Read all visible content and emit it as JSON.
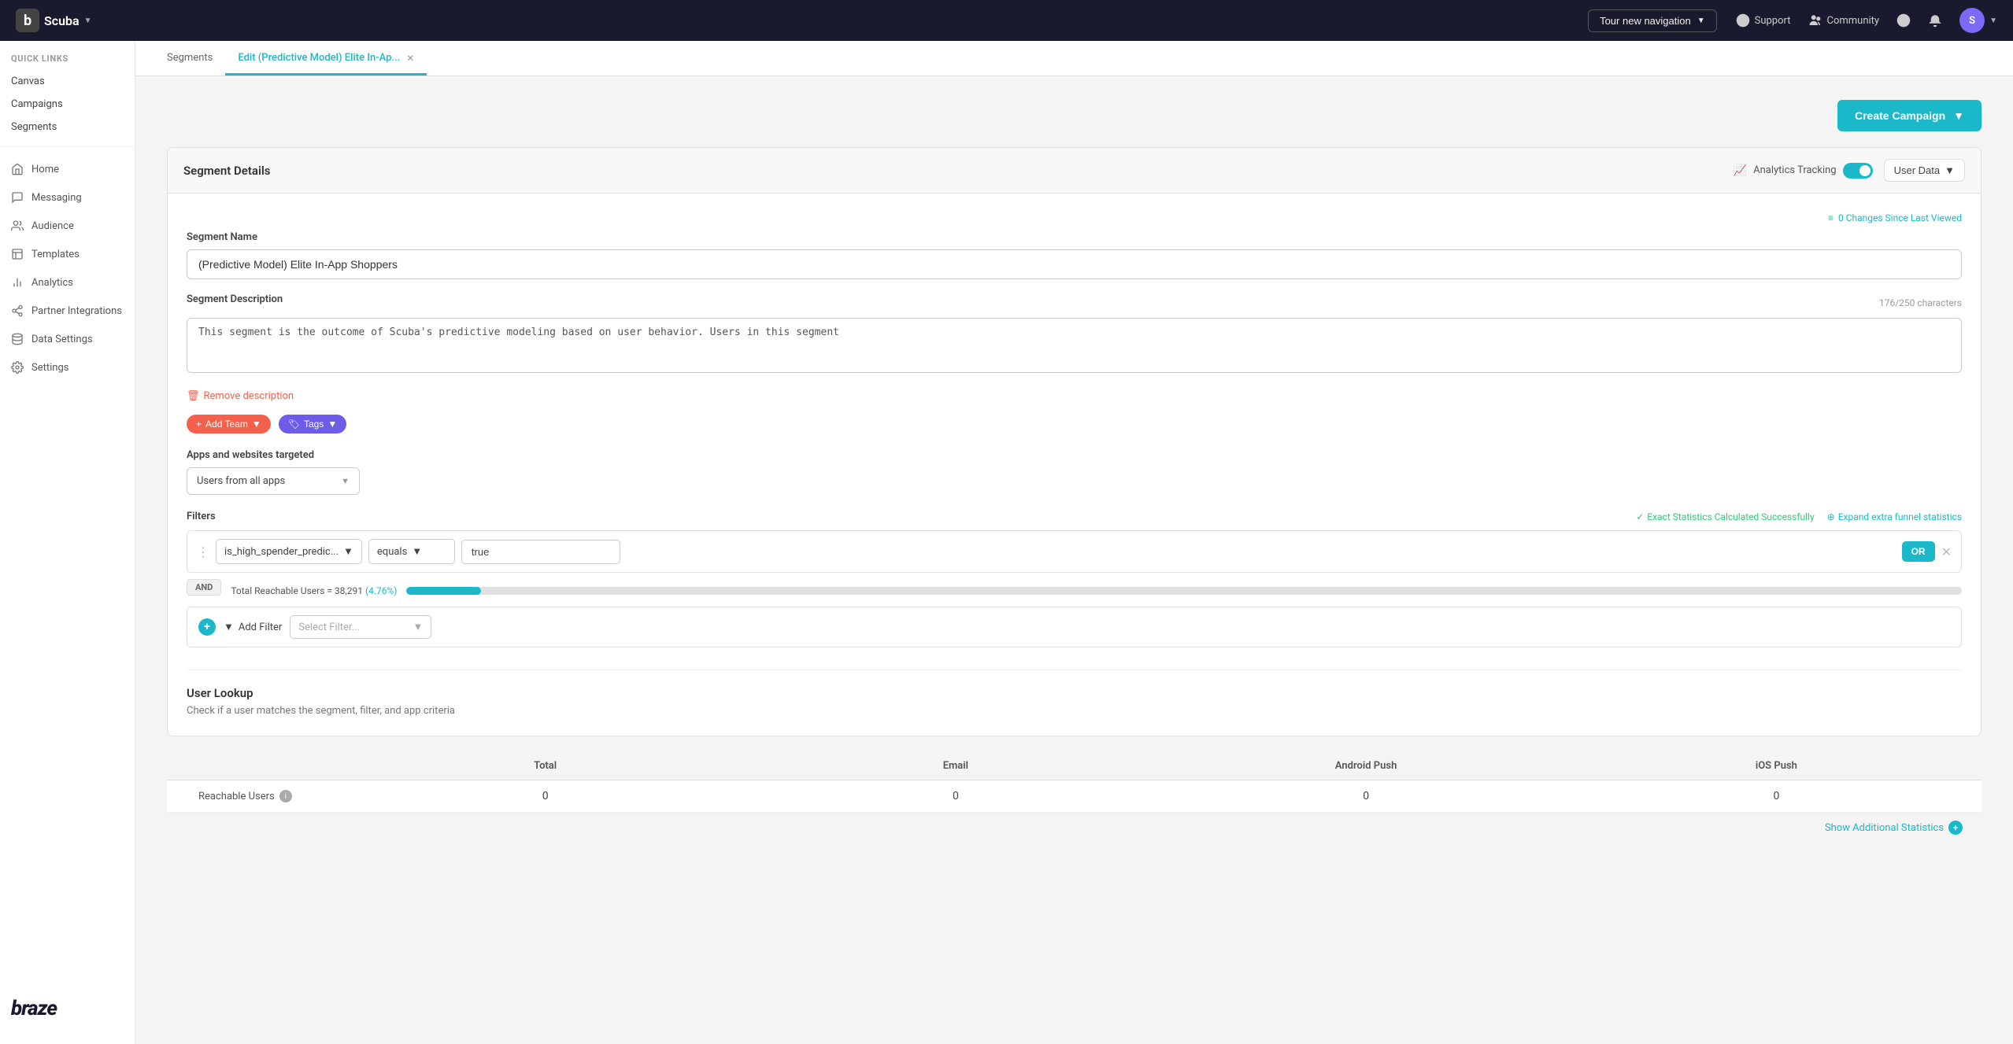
{
  "topNav": {
    "brand": "b",
    "brandName": "Scuba",
    "tourBtn": "Tour new navigation",
    "supportLabel": "Support",
    "communityLabel": "Community",
    "avatarInitial": "S"
  },
  "sidebar": {
    "quickLinksLabel": "QUICK LINKS",
    "quickLinks": [
      "Canvas",
      "Campaigns",
      "Segments"
    ],
    "navItems": [
      {
        "label": "Home",
        "icon": "home"
      },
      {
        "label": "Messaging",
        "icon": "message"
      },
      {
        "label": "Audience",
        "icon": "audience"
      },
      {
        "label": "Templates",
        "icon": "template"
      },
      {
        "label": "Analytics",
        "icon": "analytics"
      },
      {
        "label": "Partner Integrations",
        "icon": "integrations"
      },
      {
        "label": "Data Settings",
        "icon": "data"
      },
      {
        "label": "Settings",
        "icon": "settings"
      }
    ],
    "logoText": "braze"
  },
  "tabs": [
    {
      "label": "Segments",
      "active": false,
      "closable": false
    },
    {
      "label": "Edit (Predictive Model) Elite In-Ap...",
      "active": true,
      "closable": true
    }
  ],
  "createCampaign": {
    "label": "Create Campaign"
  },
  "segmentDetails": {
    "title": "Segment Details",
    "analyticsTracking": "Analytics Tracking",
    "userDataLabel": "User Data",
    "changesLabel": "0 Changes Since Last Viewed",
    "segmentNameLabel": "Segment Name",
    "segmentNameValue": "(Predictive Model) Elite In-App Shoppers",
    "segmentDescLabel": "Segment Description",
    "charCount": "176/250 characters",
    "descValue": "This segment is the outcome of Scuba's predictive modeling based on user behavior. Users in this segment",
    "removeDesc": "Remove description",
    "addTeamLabel": "Add Team",
    "tagsLabel": "Tags",
    "appsLabel": "Apps and websites targeted",
    "appsValue": "Users from all apps",
    "filtersLabel": "Filters",
    "exactStats": "Exact Statistics Calculated Successfully",
    "expandStats": "Expand extra funnel statistics",
    "filter": {
      "attribute": "is_high_spender_predic...",
      "operator": "equals",
      "value": "true"
    },
    "andBadge": "AND",
    "reachableUsers": "Total Reachable Users = 38,291",
    "reachablePct": "(4.76%)",
    "progressPct": 4.76,
    "addFilterLabel": "Add Filter",
    "selectFilterPlaceholder": "Select Filter..."
  },
  "userLookup": {
    "title": "User Lookup",
    "subtitle": "Check if a user matches the segment, filter, and app criteria"
  },
  "statsTable": {
    "headers": [
      "",
      "Total",
      "Email",
      "Android Push",
      "iOS Push"
    ],
    "rows": [
      {
        "label": "Reachable Users",
        "hasInfo": true,
        "cells": [
          "0",
          "0",
          "0",
          "0"
        ]
      }
    ]
  },
  "showAdditionalStats": "Show Additional Statistics"
}
